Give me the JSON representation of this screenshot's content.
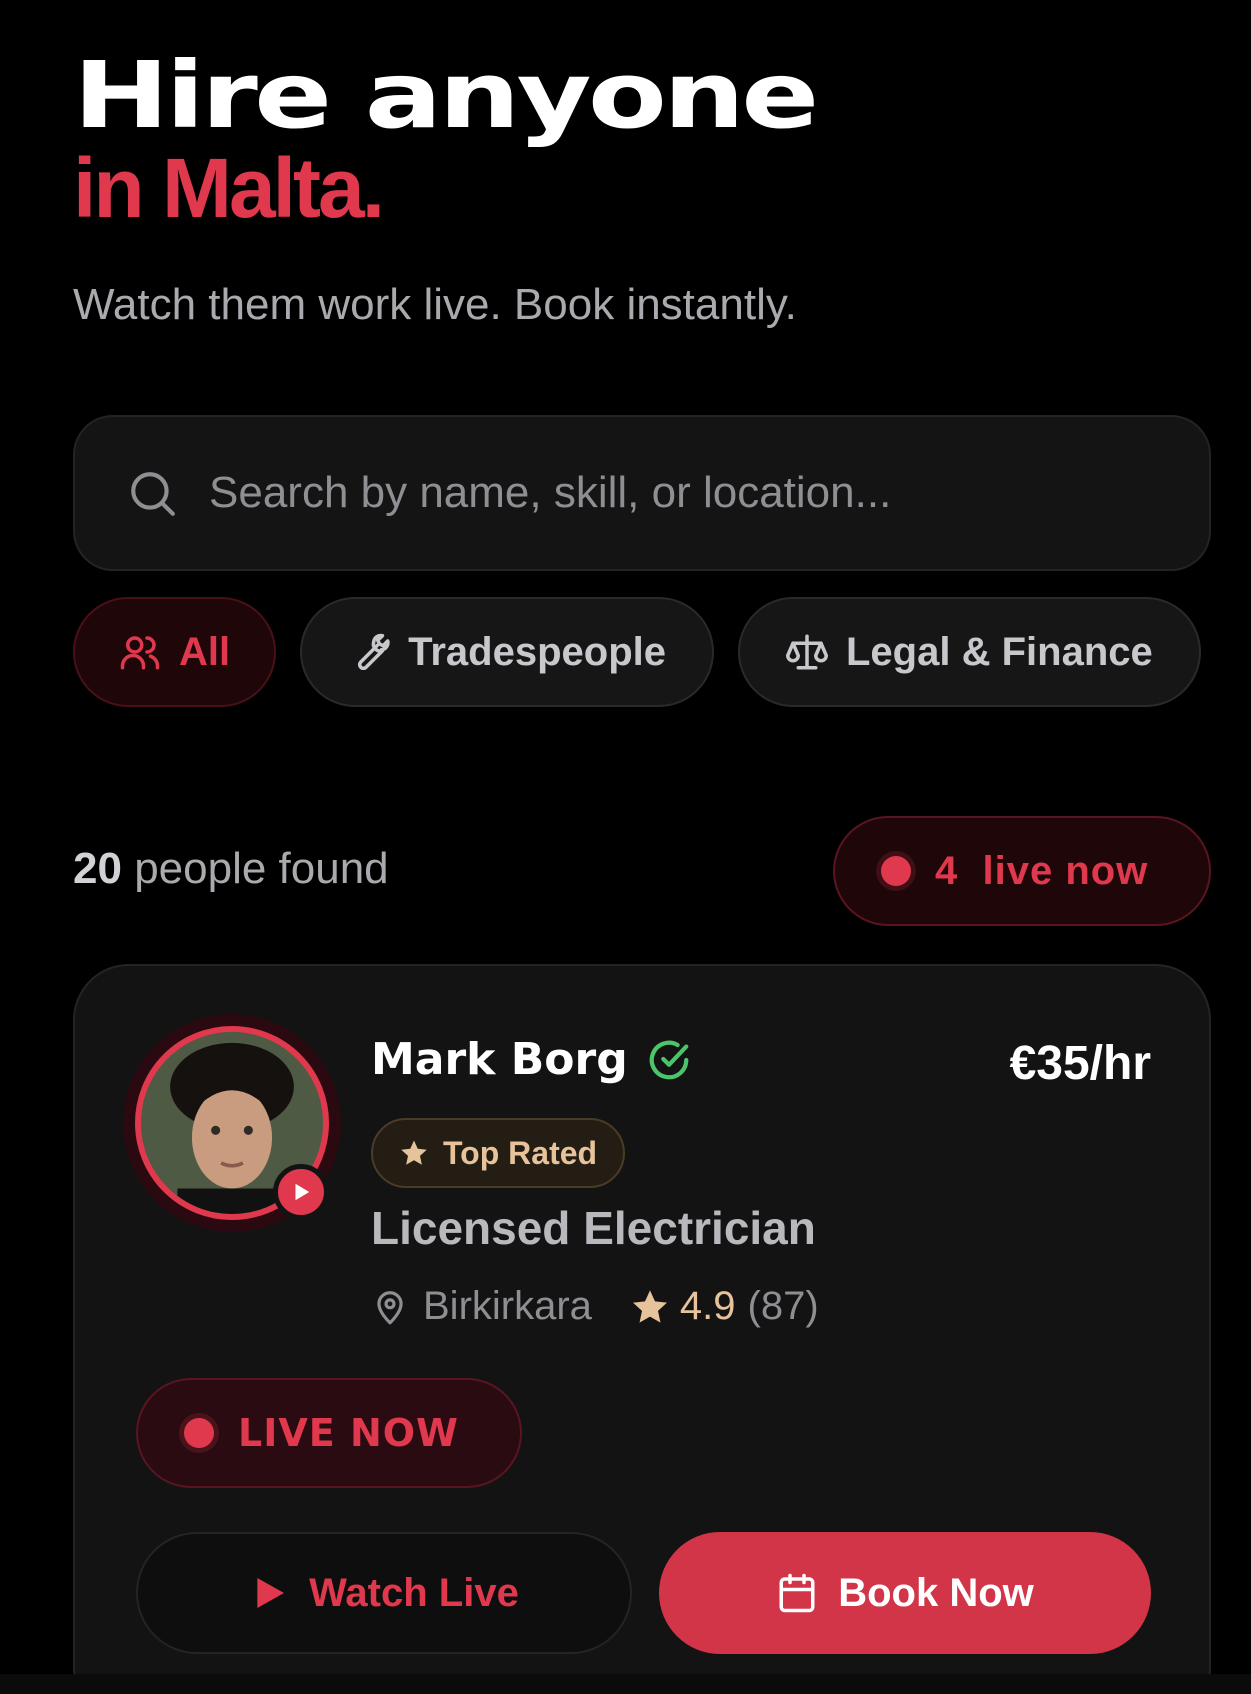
{
  "hero": {
    "title": "Hire anyone",
    "accent": "in Malta.",
    "subtitle": "Watch them work live. Book instantly."
  },
  "search": {
    "placeholder": "Search by name, skill, or location...",
    "icon": "search-icon"
  },
  "filters": [
    {
      "label": "All",
      "icon": "users-icon",
      "active": true
    },
    {
      "label": "Tradespeople",
      "icon": "wrench-icon",
      "active": false
    },
    {
      "label": "Legal & Finance",
      "icon": "scale-icon",
      "active": false
    }
  ],
  "results": {
    "count": "20",
    "count_suffix": "people found",
    "live_count": "4",
    "live_suffix": "live now"
  },
  "card": {
    "name": "Mark Borg",
    "verified_icon": "check-circle-icon",
    "price": "€35/hr",
    "badge": "Top Rated",
    "role": "Licensed Electrician",
    "location": "Birkirkara",
    "rating": "4.9",
    "reviews": "(87)",
    "live_label": "LIVE NOW",
    "watch_label": "Watch Live",
    "book_label": "Book Now"
  },
  "colors": {
    "accent": "#e0384d",
    "background": "#000000",
    "card": "#131313",
    "gold": "#e6c39a",
    "verified": "#4cc46a"
  }
}
